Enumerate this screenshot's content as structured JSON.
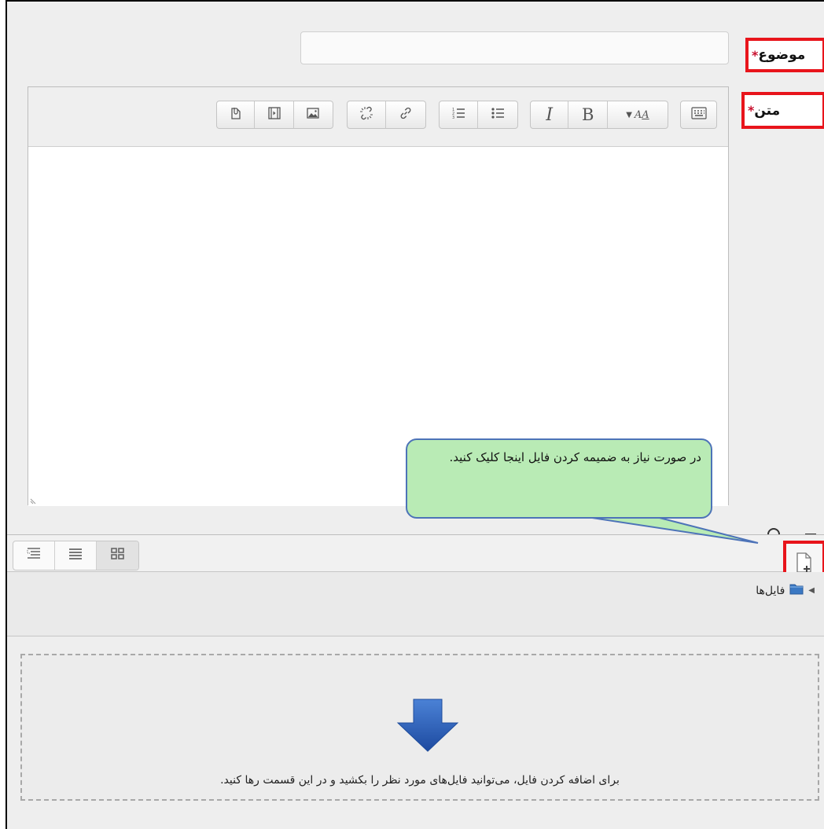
{
  "form": {
    "subject_label": "موضوع",
    "message_label": "متن",
    "required_mark": "*",
    "subject_value": ""
  },
  "editor": {
    "toolbar_icons": [
      "show-more-icon",
      "font-color-icon",
      "bold-icon",
      "italic-icon",
      "unordered-list-icon",
      "ordered-list-icon",
      "link-icon",
      "unlink-icon",
      "image-icon",
      "media-icon",
      "manage-files-icon"
    ],
    "bold_text": "B",
    "italic_text": "I",
    "font_color_text": "A",
    "content": ""
  },
  "callout": {
    "text": "در صورت نیاز به ضمیمه کردن فایل اینجا کلیک کنید."
  },
  "filepicker": {
    "path_label": "فایل‌ها",
    "drop_text": "برای اضافه کردن فایل، می‌توانید فایل‌های مورد نظر را بکشید و در این قسمت رها کنید.",
    "views": [
      "tree-view-icon",
      "list-view-icon",
      "grid-view-icon"
    ],
    "active_view": "grid-view-icon"
  },
  "colors": {
    "annotation_red": "#e8141b",
    "callout_fill": "#b9ebb5",
    "callout_border": "#4d73b8",
    "drop_arrow": "#2a5fb0"
  }
}
